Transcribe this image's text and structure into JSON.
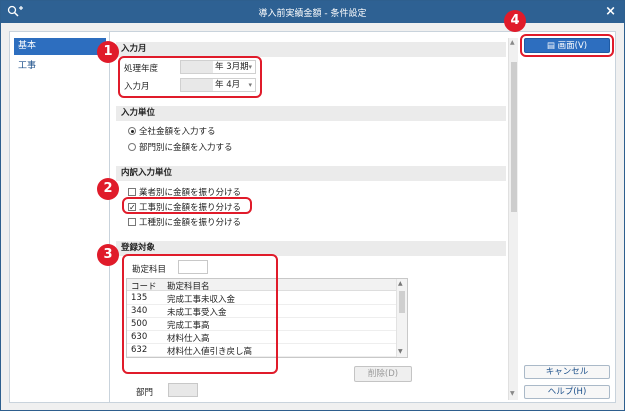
{
  "window": {
    "title": "導入前実績金額 - 条件設定",
    "close_symbol": "×"
  },
  "sidebar": {
    "items": [
      {
        "label": "基本",
        "active": true
      },
      {
        "label": "工事",
        "active": false
      }
    ]
  },
  "sections": {
    "input_month": {
      "header": "入力月",
      "fiscal_year_label": "処理年度",
      "fiscal_year_value": "年  3月期",
      "input_month_label": "入力月",
      "input_month_value": "年  4月"
    },
    "input_unit": {
      "header": "入力単位",
      "option_company": "全社金額を入力する",
      "option_department": "部門別に金額を入力する",
      "selected": "company"
    },
    "breakdown": {
      "header": "内訳入力単位",
      "option_vendor": "業者別に金額を振り分ける",
      "option_project": "工事別に金額を振り分ける",
      "option_type": "工種別に金額を振り分ける",
      "checked": "project"
    },
    "registration": {
      "header": "登録対象",
      "account_label": "勘定科目",
      "columns": {
        "code": "コード",
        "name": "勘定科目名"
      },
      "rows": [
        {
          "code": "135",
          "name": "完成工事未収入金"
        },
        {
          "code": "340",
          "name": "未成工事受入金"
        },
        {
          "code": "500",
          "name": "完成工事高"
        },
        {
          "code": "630",
          "name": "材料仕入高"
        },
        {
          "code": "632",
          "name": "材料仕入値引き戻し高"
        }
      ],
      "delete_button": "削除(D)",
      "department_label": "部門"
    }
  },
  "right_panel": {
    "screen_button": "画面(V)",
    "cancel_button": "キャンセル",
    "help_button": "ヘルプ(H)"
  },
  "annotations": {
    "badges": [
      "1",
      "2",
      "3",
      "4"
    ]
  },
  "colors": {
    "titlebar": "#2e6193",
    "accent": "#2d6ebf",
    "annotation": "#e01b2a"
  }
}
